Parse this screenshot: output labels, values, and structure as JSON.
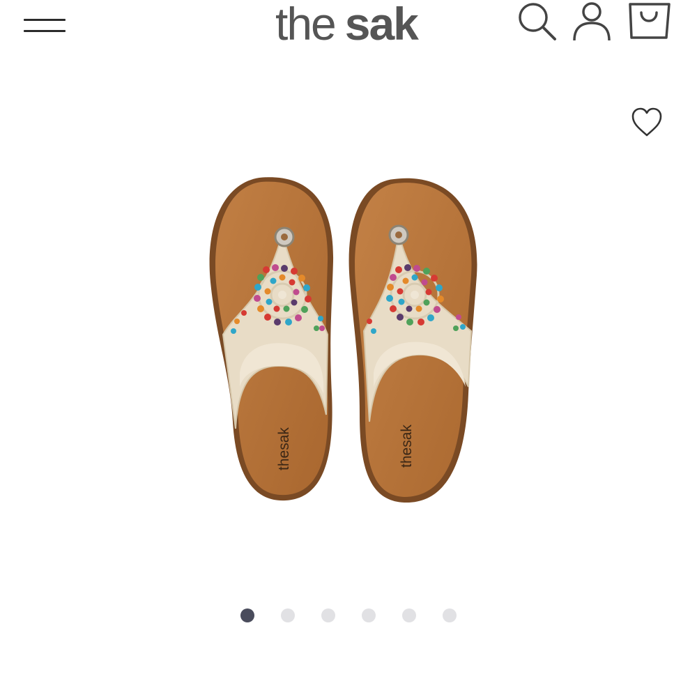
{
  "header": {
    "logo": {
      "part1": "the",
      "part2": "sak"
    },
    "icons": [
      "menu-icon",
      "search-icon",
      "user-icon",
      "shopping-bag-icon"
    ]
  },
  "product": {
    "image_brand_mark": "thesak",
    "wishlist_icon": "heart-icon",
    "colors": {
      "footbed": "#b9773c",
      "crochet": "#e8dcc6",
      "beads": [
        "#d63a33",
        "#2fa6c9",
        "#e48a2a",
        "#c04b8e",
        "#5a3b6c",
        "#4fa15a"
      ]
    }
  },
  "carousel": {
    "total": 6,
    "active": 1,
    "active_color": "#4a4c5c",
    "inactive_color": "#e1e1e4"
  }
}
